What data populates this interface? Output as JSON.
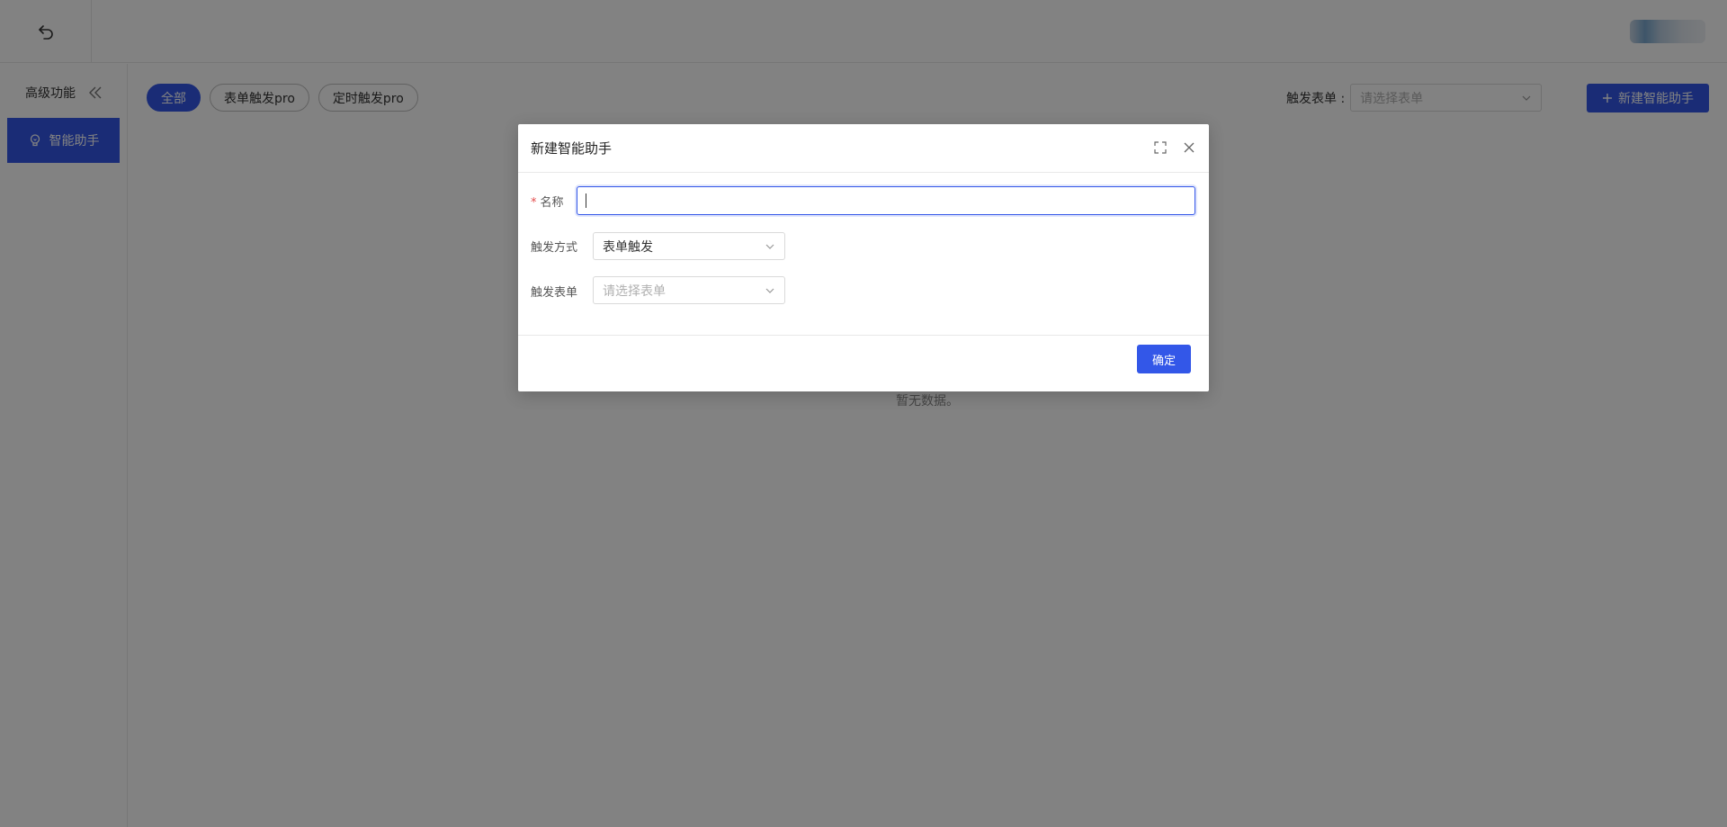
{
  "sidebar": {
    "title": "高级功能",
    "items": [
      {
        "label": "智能助手",
        "icon": "lightbulb-icon"
      }
    ]
  },
  "filters": {
    "chips": [
      {
        "label": "全部",
        "active": true
      },
      {
        "label": "表单触发pro",
        "active": false
      },
      {
        "label": "定时触发pro",
        "active": false
      }
    ],
    "trigger_form_label": "触发表单 :",
    "trigger_form_placeholder": "请选择表单"
  },
  "toolbar": {
    "new_button_label": "新建智能助手"
  },
  "main": {
    "empty_text": "暂无数据。"
  },
  "modal": {
    "title": "新建智能助手",
    "fields": {
      "name_label": "名称",
      "name_value": "",
      "trigger_mode_label": "触发方式",
      "trigger_mode_value": "表单触发",
      "trigger_form_label": "触发表单",
      "trigger_form_placeholder": "请选择表单"
    },
    "confirm_label": "确定"
  },
  "colors": {
    "accent": "#3357e8",
    "required": "#e34d4d",
    "overlay": "rgba(0,0,0,0.49)"
  }
}
